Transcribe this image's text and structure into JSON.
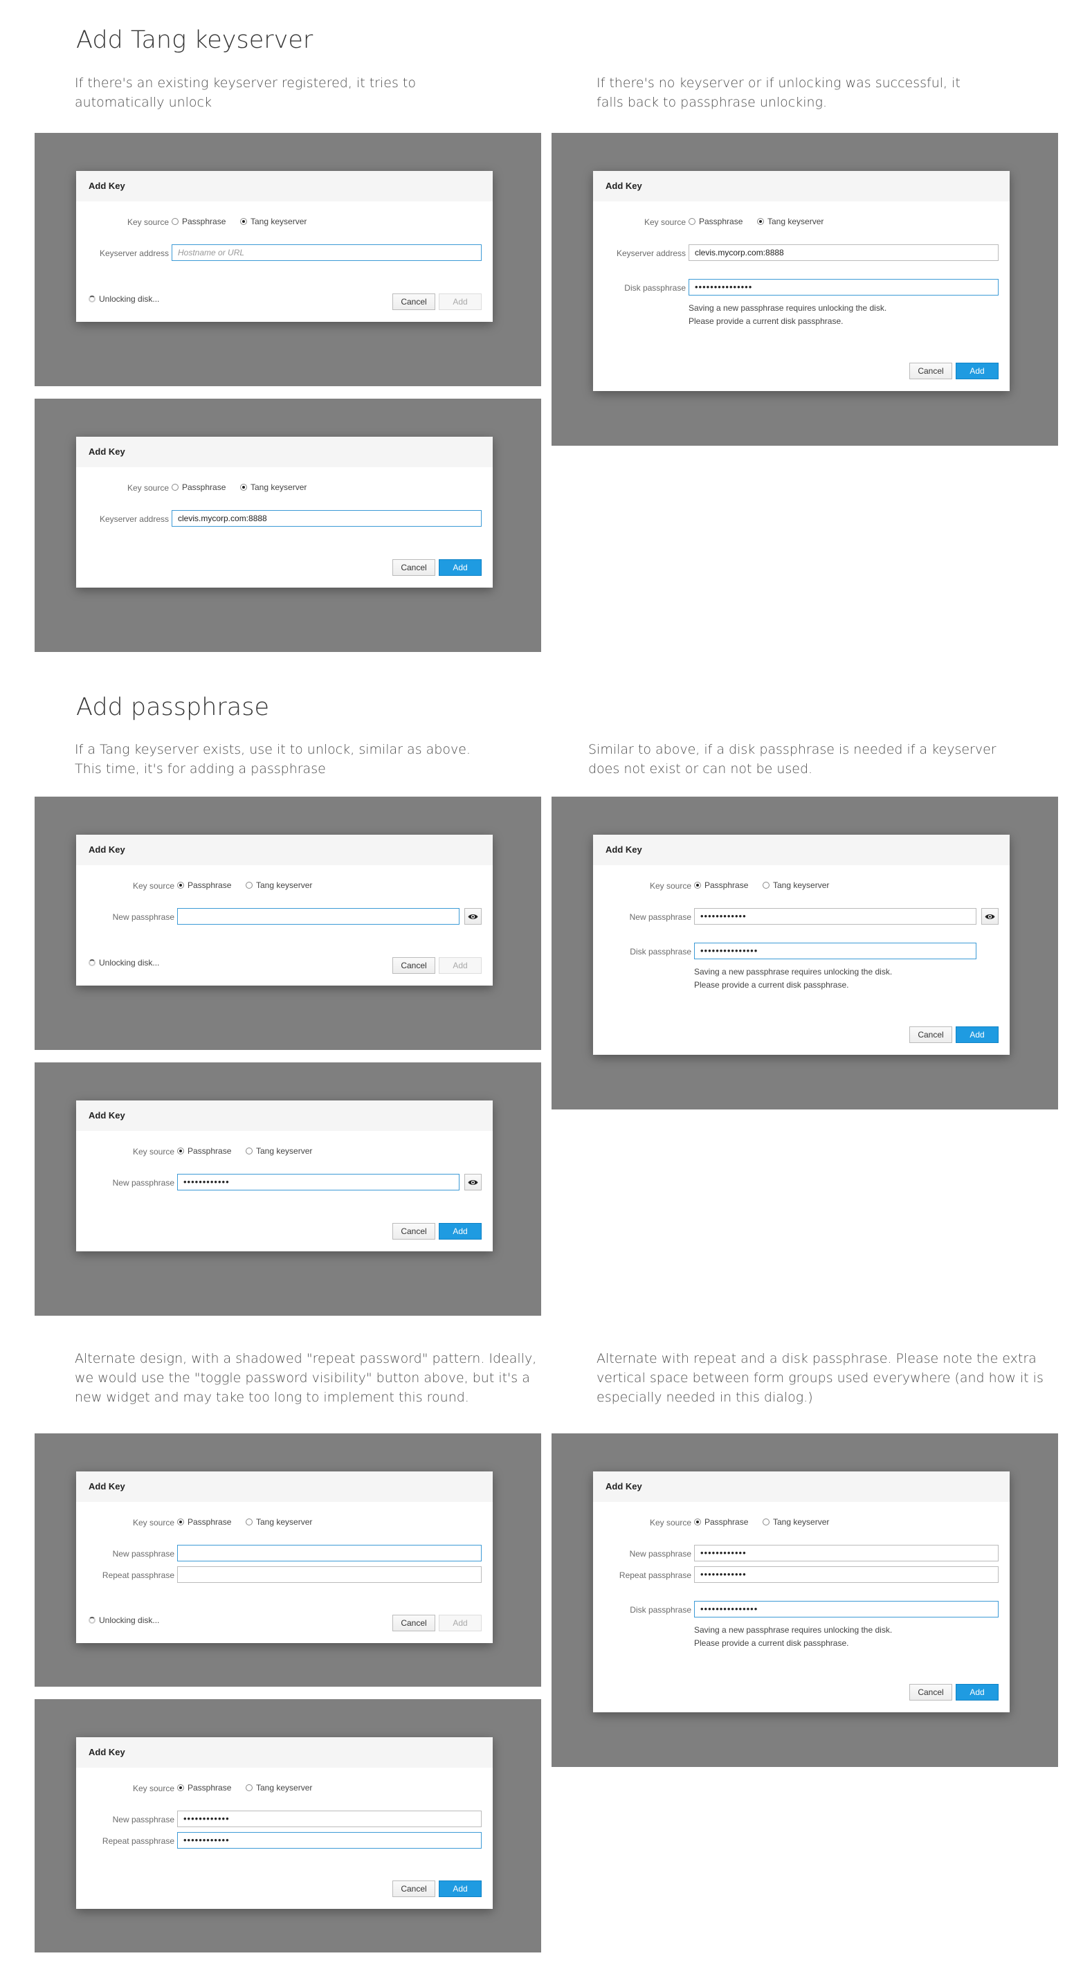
{
  "dialog": {
    "title": "Add Key",
    "key_source_label": "Key source",
    "opt_passphrase": "Passphrase",
    "opt_tang": "Tang keyserver",
    "keyserver_label": "Keyserver address",
    "keyserver_placeholder": "Hostname or URL",
    "keyserver_value": "clevis.mycorp.com:8888",
    "new_pass_label": "New passphrase",
    "repeat_pass_label": "Repeat passphrase",
    "disk_pass_label": "Disk passphrase",
    "new_pass_mask": "••••••••••••",
    "disk_pass_mask": "•••••••••••••••",
    "help_line1": "Saving a new passphrase requires unlocking the disk.",
    "help_line2": "Please provide a current disk passphrase.",
    "unlocking": "Unlocking disk...",
    "cancel": "Cancel",
    "add": "Add"
  },
  "section1": {
    "heading": "Add Tang keyserver",
    "left_desc_1": "If there's an existing keyserver registered, it tries to",
    "left_desc_2": "automatically unlock",
    "right_desc_1": "If there's no keyserver or if unlocking was successful, it",
    "right_desc_2": "falls back to passphrase unlocking."
  },
  "section2": {
    "heading": "Add passphrase",
    "left_desc_1": "If a Tang keyserver exists, use it to unlock, similar as above.",
    "left_desc_2": "This time, it's for adding a passphrase",
    "right_desc_1": "Similar to above, if a disk passphrase is needed if a keyserver",
    "right_desc_2": "does not exist or can not be used."
  },
  "section3": {
    "left_desc_1": "Alternate design, with a shadowed \"repeat password\" pattern. Ideally,",
    "left_desc_2": "we would use the \"toggle password visibility\" button above, but it's a",
    "left_desc_3": "new widget and may take too long to implement this round.",
    "right_desc_1": "Alternate with repeat and a disk passphrase. Please note the extra",
    "right_desc_2": "vertical space between form groups used everywhere (and how it is",
    "right_desc_3": "especially needed in this dialog.)"
  },
  "icons": [
    "spinner-icon",
    "eye-icon",
    "radio-icon"
  ],
  "colors": {
    "panel": "#7f7f7f",
    "primary": "#1f9be1",
    "focus": "#3c9ad6"
  }
}
